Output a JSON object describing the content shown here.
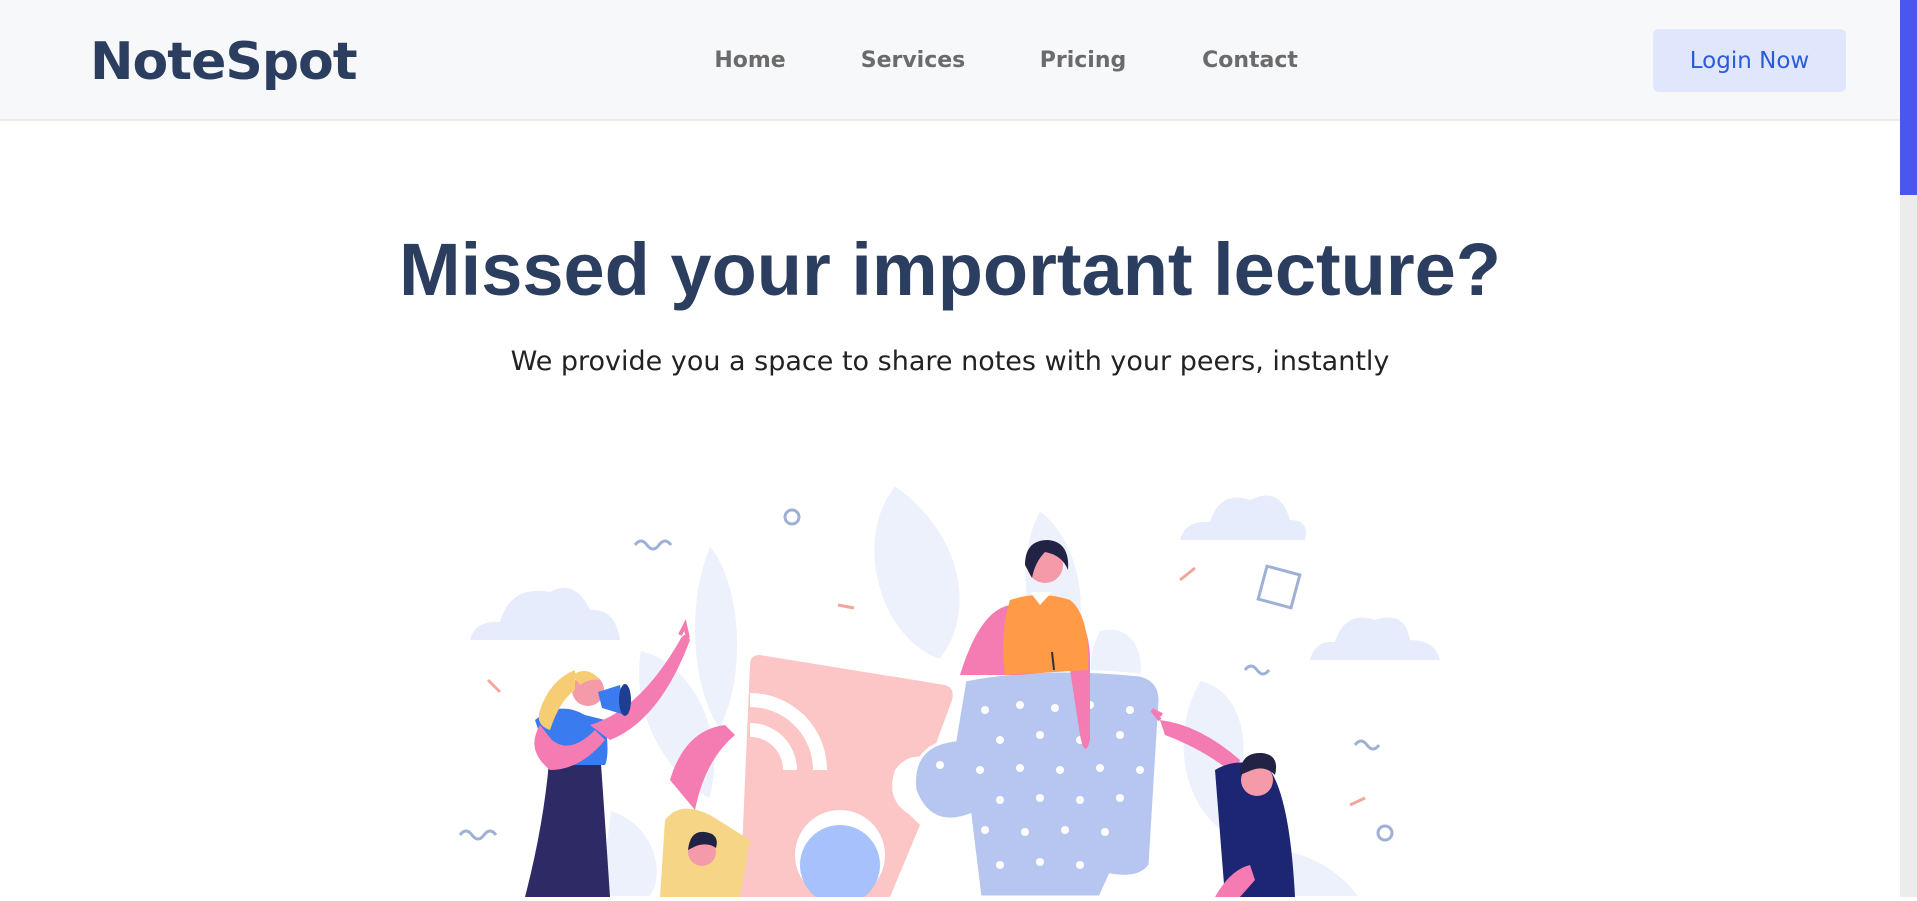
{
  "app": {
    "brand": "NoteSpot"
  },
  "nav": {
    "items": [
      {
        "label": "Home"
      },
      {
        "label": "Services"
      },
      {
        "label": "Pricing"
      },
      {
        "label": "Contact"
      }
    ],
    "login_label": "Login Now"
  },
  "hero": {
    "title": "Missed your important lecture?",
    "subtitle": "We provide you a space to share notes with your peers, instantly"
  },
  "colors": {
    "brand_dark": "#2c3e5f",
    "accent_blue": "#2a5bd8",
    "login_bg": "#e0e7fc",
    "scroll_thumb": "#4a56ee"
  },
  "illustration": {
    "icon": "team-puzzle-illustration"
  }
}
